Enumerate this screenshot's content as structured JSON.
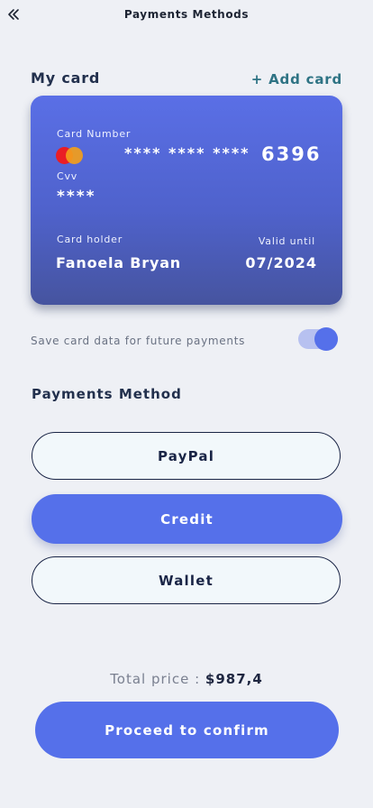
{
  "header": {
    "title": "Payments Methods",
    "back_icon": "double-chevron-left-icon"
  },
  "my_card": {
    "heading": "My card",
    "add_card_label": "+ Add card",
    "card": {
      "number_label": "Card Number",
      "number_mask": "**** **** ****",
      "number_last4": "6396",
      "cvv_label": "Cvv",
      "cvv_value": "****",
      "holder_label": "Card holder",
      "holder_name": "Fanoela Bryan",
      "valid_label": "Valid until",
      "valid_date": "07/2024",
      "brand_icon": "mastercard-icon",
      "gradient_colors": [
        "#5a6fe6",
        "#46549f"
      ]
    }
  },
  "save_card": {
    "label": "Save card data for future payments",
    "enabled": true
  },
  "payment_methods": {
    "heading": "Payments Method",
    "options": [
      {
        "label": "PayPal",
        "selected": false
      },
      {
        "label": "Credit",
        "selected": true
      },
      {
        "label": "Wallet",
        "selected": false
      }
    ]
  },
  "footer": {
    "total_label": "Total price :",
    "total_value": "$987,4",
    "confirm_label": "Proceed to confirm"
  },
  "colors": {
    "accent": "#5570ea",
    "link": "#2e7384",
    "background": "#eef0f5"
  }
}
